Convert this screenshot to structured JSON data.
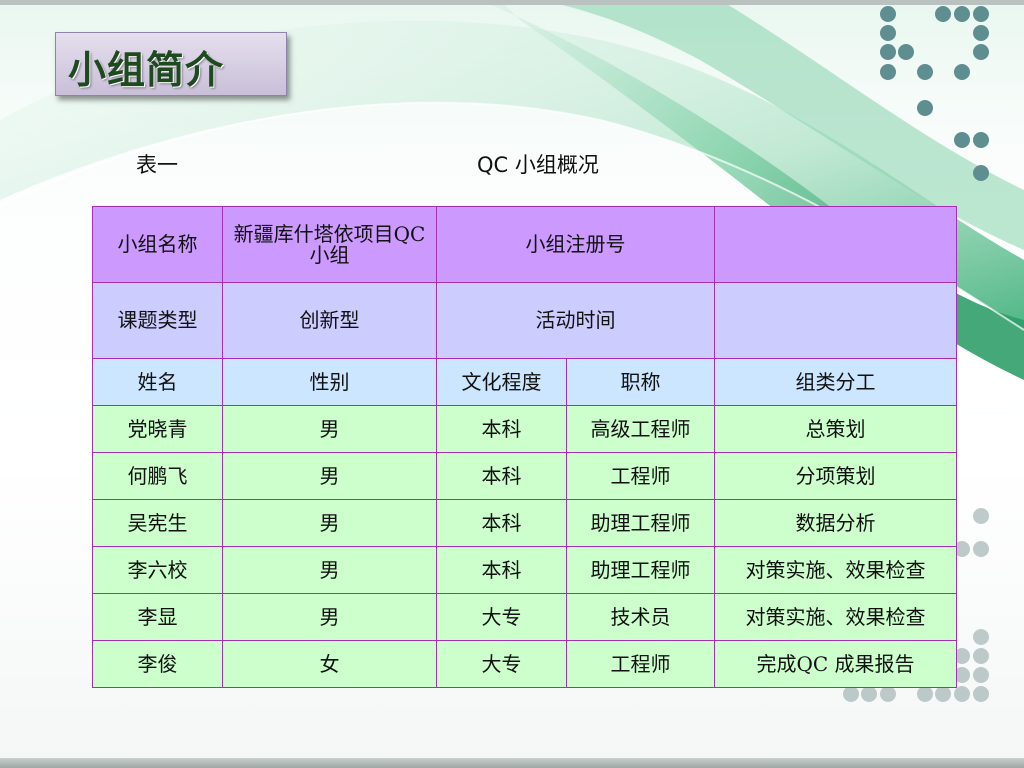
{
  "slide": {
    "title": "小组简介",
    "table_label": "表一",
    "table_caption": "QC 小组概况"
  },
  "table": {
    "info_rows": [
      {
        "label": "小组名称",
        "value": "新疆库什塔依项目QC 小组",
        "field": "小组注册号",
        "field_value": ""
      },
      {
        "label": "课题类型",
        "value": "创新型",
        "field": "活动时间",
        "field_value": ""
      }
    ],
    "headers": [
      "姓名",
      "性别",
      "文化程度",
      "职称",
      "组类分工"
    ],
    "members": [
      {
        "name": "党晓青",
        "gender": "男",
        "education": "本科",
        "title": "高级工程师",
        "role": "总策划"
      },
      {
        "name": "何鹏飞",
        "gender": "男",
        "education": "本科",
        "title": "工程师",
        "role": "分项策划"
      },
      {
        "name": "吴宪生",
        "gender": "男",
        "education": "本科",
        "title": "助理工程师",
        "role": "数据分析"
      },
      {
        "name": "李六校",
        "gender": "男",
        "education": "本科",
        "title": "助理工程师",
        "role": "对策实施、效果检查"
      },
      {
        "name": "李显",
        "gender": "男",
        "education": "大专",
        "title": "技术员",
        "role": "对策实施、效果检查"
      },
      {
        "name": "李俊",
        "gender": "女",
        "education": "大专",
        "title": "工程师",
        "role": "完成QC 成果报告"
      }
    ]
  },
  "colors": {
    "title_text": "#1d4a1e",
    "table_border": "#a62fb8",
    "row_name_bg": "#cc99ff",
    "row_topic_bg": "#ccccff",
    "row_header_bg": "#cce6ff",
    "row_member_bg": "#ccffcc",
    "dot_color": "#5f8e90",
    "wave_green": "#2f9e6a"
  }
}
